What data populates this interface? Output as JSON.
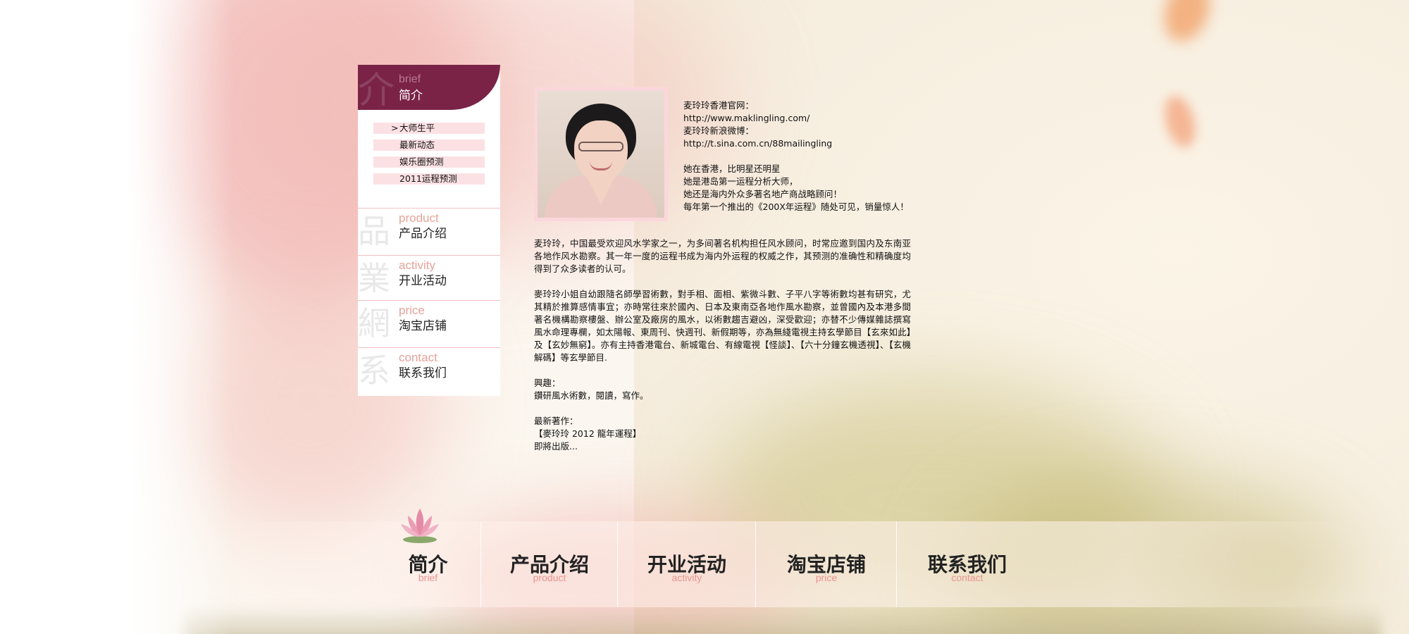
{
  "sidebar": {
    "header": {
      "watermark": "介",
      "en": "brief",
      "zh": "简介"
    },
    "submenu": [
      {
        "label": "大师生平",
        "arrow": ">"
      },
      {
        "label": "最新动态"
      },
      {
        "label": "娱乐圈预测"
      },
      {
        "label": "2011运程预测"
      }
    ],
    "sections": [
      {
        "watermark": "品",
        "en": "product",
        "zh": "产品介绍"
      },
      {
        "watermark": "業",
        "en": "activity",
        "zh": "开业活动"
      },
      {
        "watermark": "網",
        "en": "price",
        "zh": "淘宝店铺"
      },
      {
        "watermark": "系",
        "en": "contact",
        "zh": "联系我们"
      }
    ]
  },
  "info": {
    "line1": "麦玲玲香港官网：",
    "line2": "http://www.maklingling.com/",
    "line3": "麦玲玲新浪微博：",
    "line4": "http://t.sina.com.cn/88mailingling",
    "line5": "她在香港，比明星还明星",
    "line6": "她是港岛第一运程分析大师，",
    "line7": "她还是海内外众多著名地产商战略顾问！",
    "line8": "每年第一个推出的《200X年运程》随处可见，销量惊人！"
  },
  "bio": {
    "p1": "麦玲玲，中国最受欢迎风水学家之一，为多间著名机构担任风水顾问，时常应邀到国内及东南亚各地作风水勘察。其一年一度的运程书成为海内外运程的权威之作，其预测的准确性和精确度均得到了众多读者的认可。",
    "p2": "麥玲玲小姐自幼跟隨名師學習術數，對手相、面相、紫微斗數、子平八字等術數均甚有研究，尤其精於推算感情事宜；亦時常往來於國內、日本及東南亞各地作風水勘察，並曾國內及本港多間著名機構勘察樓盤、辦公室及廠房的風水，以術數趨吉避凶，深受歡迎；亦替不少傳媒雜誌撰寫風水命理專欄，如太陽報、東周刊、快週刊、新假期等，亦為無綫電視主持玄學節目【玄來如此】及【玄妙無窮】。亦有主持香港電台、新城電台、有線電視【怪談】、【六十分鐘玄機透視】、【玄機解碼】等玄學節目.",
    "hobby_label": "興趣：",
    "hobby": "鑽研風水術數，閱讀，寫作。",
    "works_label": "最新著作：",
    "works": "【麥玲玲 2012 龍年運程】",
    "works_note": "即將出版..."
  },
  "bottom_nav": [
    {
      "zh": "简介",
      "en": "brief"
    },
    {
      "zh": "产品介绍",
      "en": "product"
    },
    {
      "zh": "开业活动",
      "en": "activity"
    },
    {
      "zh": "淘宝店铺",
      "en": "price"
    },
    {
      "zh": "联系我们",
      "en": "contact"
    }
  ],
  "colors": {
    "header_bg": "#7a2347",
    "submenu_bg": "#fbe1e4",
    "accent_en": "#e9948f"
  }
}
